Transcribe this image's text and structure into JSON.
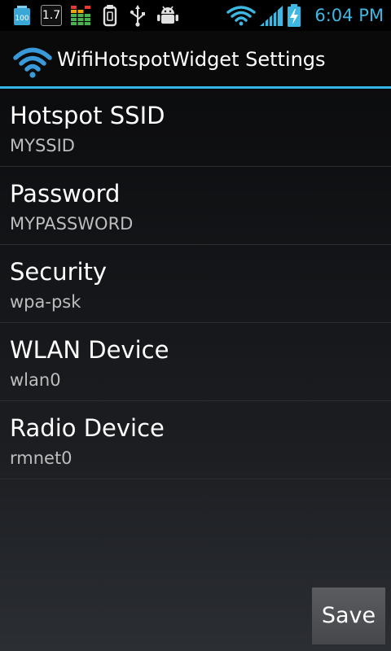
{
  "status_bar": {
    "badge_100": "100",
    "badge_17": "1.7",
    "clock": "6:04 PM",
    "icons": [
      "battery-100-badge",
      "cpu-badge",
      "equalizer-icon",
      "clipboard-icon",
      "usb-icon",
      "android-debug-icon",
      "wifi-signal-icon",
      "cell-signal-icon",
      "battery-charging-icon"
    ]
  },
  "header": {
    "title": "WifiHotspotWidget Settings",
    "icon": "wifi-icon",
    "accent_color": "#33b5e5"
  },
  "preferences": [
    {
      "title": "Hotspot SSID",
      "summary": "MYSSID"
    },
    {
      "title": "Password",
      "summary": "MYPASSWORD"
    },
    {
      "title": "Security",
      "summary": "wpa-psk"
    },
    {
      "title": "WLAN Device",
      "summary": "wlan0"
    },
    {
      "title": "Radio Device",
      "summary": "rmnet0"
    }
  ],
  "actions": {
    "save_label": "Save"
  }
}
